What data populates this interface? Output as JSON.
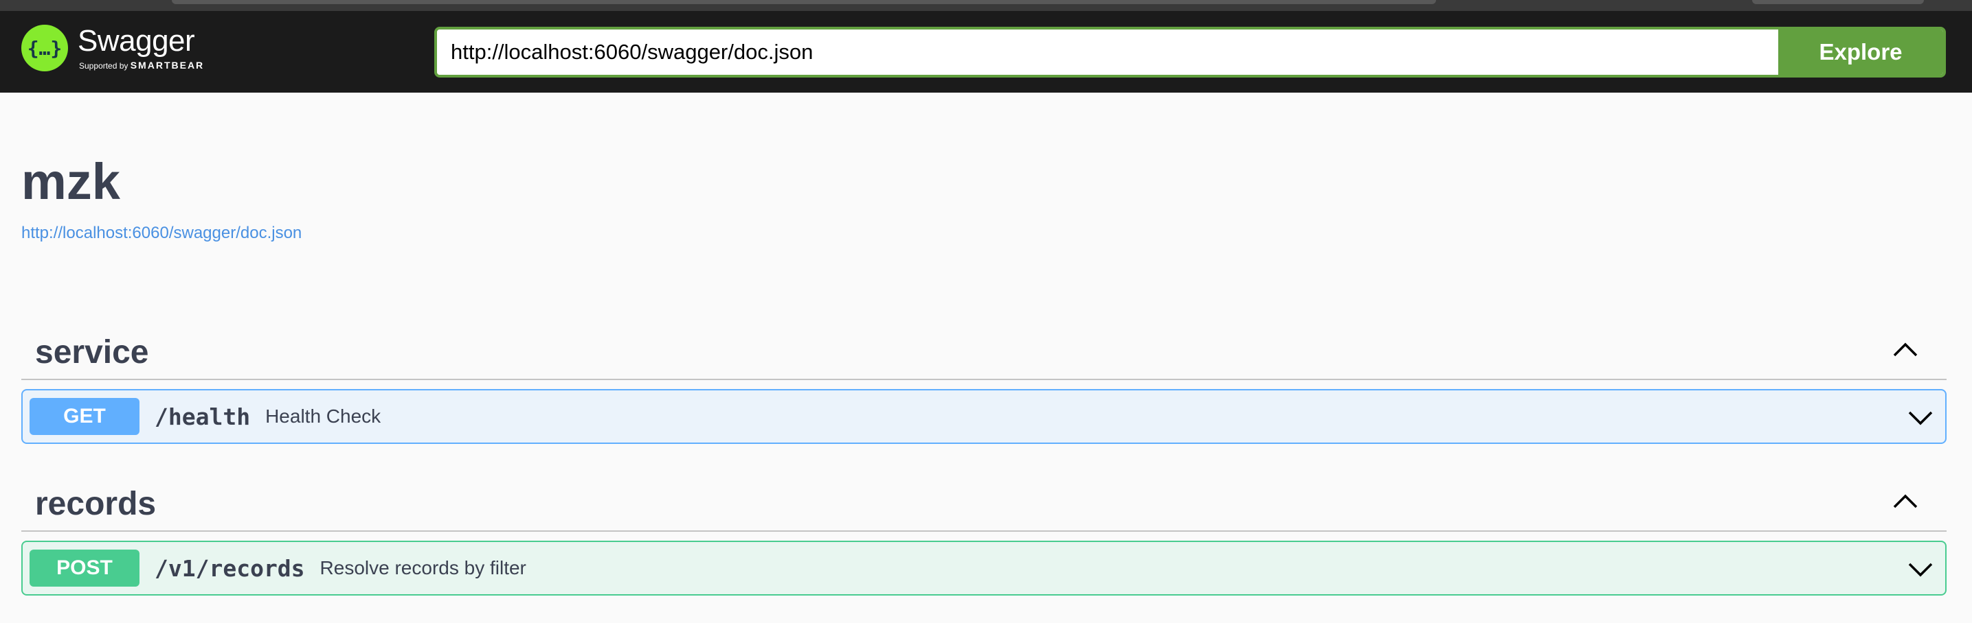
{
  "topbar": {
    "logo_glyph": "{…}",
    "logo_title": "Swagger",
    "logo_sub_prefix": "Supported by ",
    "logo_sub_brand": "SMARTBEAR",
    "url_value": "http://localhost:6060/swagger/doc.json",
    "explore_label": "Explore"
  },
  "info": {
    "title": "mzk",
    "spec_link": "http://localhost:6060/swagger/doc.json"
  },
  "tags": [
    {
      "name": "service",
      "operations": [
        {
          "method": "GET",
          "path": "/health",
          "summary": "Health Check"
        }
      ]
    },
    {
      "name": "records",
      "operations": [
        {
          "method": "POST",
          "path": "/v1/records",
          "summary": "Resolve records by filter"
        }
      ]
    }
  ],
  "colors": {
    "get": "#61affe",
    "post": "#49cc90",
    "explore": "#62a03f",
    "logo": "#85ea2d",
    "link": "#4990e2"
  },
  "icons": {
    "tag_toggle": "chevron-up-icon",
    "op_expand": "chevron-down-icon"
  }
}
